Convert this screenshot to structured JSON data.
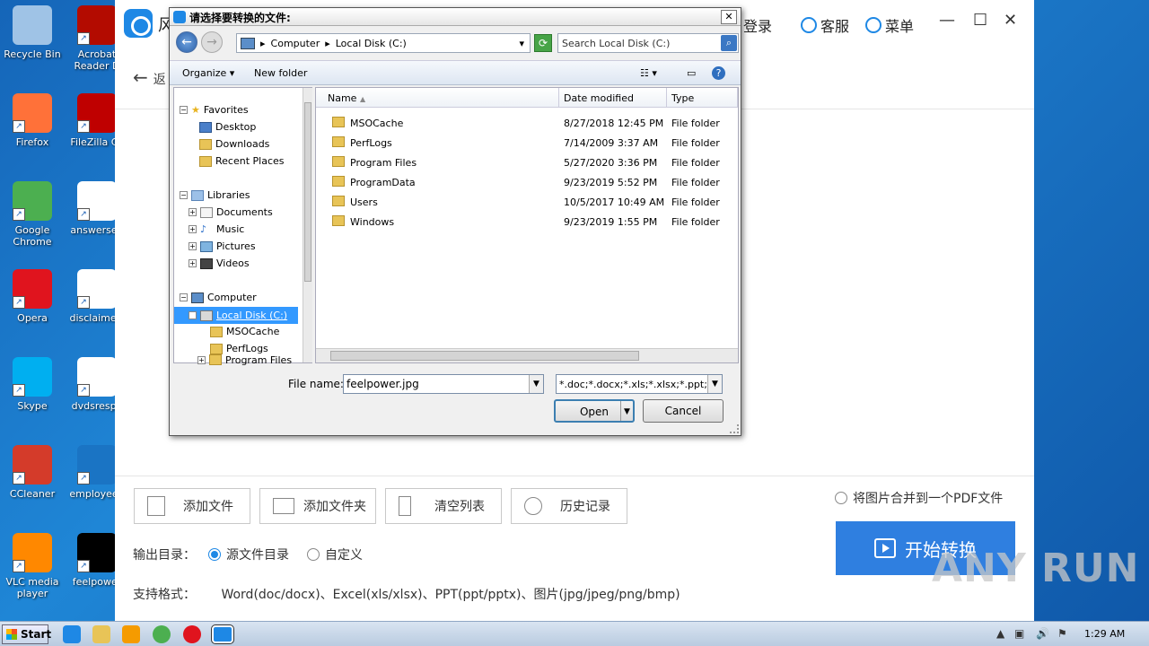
{
  "desktop": {
    "icons": [
      {
        "label": "Recycle Bin",
        "icon": "recycle-bin-icon",
        "color": "#9fc3e6"
      },
      {
        "label": "Firefox",
        "icon": "firefox-icon",
        "color": "#ff7139"
      },
      {
        "label": "Google Chrome",
        "icon": "chrome-icon",
        "color": "#4caf50"
      },
      {
        "label": "Opera",
        "icon": "opera-icon",
        "color": "#e0141e"
      },
      {
        "label": "Skype",
        "icon": "skype-icon",
        "color": "#00aff0"
      },
      {
        "label": "CCleaner",
        "icon": "ccleaner-icon",
        "color": "#d43b2a"
      },
      {
        "label": "VLC media player",
        "icon": "vlc-icon",
        "color": "#ff8800"
      },
      {
        "label": "Acrobat Reader D",
        "icon": "acrobat-icon",
        "color": "#b30b00"
      },
      {
        "label": "FileZilla Cli",
        "icon": "filezilla-icon",
        "color": "#bf0000"
      },
      {
        "label": "answersen",
        "icon": "word-doc-icon",
        "color": "#ffffff"
      },
      {
        "label": "disclaimerr",
        "icon": "word-doc-icon",
        "color": "#ffffff"
      },
      {
        "label": "dvdsrespe",
        "icon": "word-doc-icon",
        "color": "#ffffff"
      },
      {
        "label": "employeep",
        "icon": "blank-icon",
        "color": "#1a74c4"
      },
      {
        "label": "feelpower",
        "icon": "image-file-icon",
        "color": "#000000"
      }
    ]
  },
  "app": {
    "title": "风",
    "login": "登录",
    "service": "客服",
    "menu": "菜单",
    "back_label": "返",
    "actions": {
      "add_file": "添加文件",
      "add_folder": "添加文件夹",
      "clear_list": "清空列表",
      "history": "历史记录"
    },
    "merge_label": "将图片合并到一个PDF文件",
    "start_label": "开始转换",
    "output_dir_label": "输出目录：",
    "output_source": "源文件目录",
    "output_custom": "自定义",
    "formats_label": "支持格式：",
    "formats_value": "Word(doc/docx)、Excel(xls/xlsx)、PPT(ppt/pptx)、图片(jpg/jpeg/png/bmp)",
    "accent": "#2f7fe0"
  },
  "watermark": "ANY RUN",
  "dialog": {
    "title": "请选择要转换的文件:",
    "breadcrumb": [
      "Computer",
      "Local Disk (C:)"
    ],
    "search_placeholder": "Search Local Disk (C:)",
    "organize": "Organize",
    "new_folder": "New folder",
    "nav": {
      "favorites": "Favorites",
      "desktop": "Desktop",
      "downloads": "Downloads",
      "recent_places": "Recent Places",
      "libraries": "Libraries",
      "documents": "Documents",
      "music": "Music",
      "pictures": "Pictures",
      "videos": "Videos",
      "computer": "Computer",
      "local_disk": "Local Disk (C:)",
      "msocache": "MSOCache",
      "perflogs": "PerfLogs",
      "program_files": "Program Files"
    },
    "columns": {
      "name": "Name",
      "date": "Date modified",
      "type": "Type"
    },
    "files": [
      {
        "name": "MSOCache",
        "date": "8/27/2018 12:45 PM",
        "type": "File folder"
      },
      {
        "name": "PerfLogs",
        "date": "7/14/2009 3:37 AM",
        "type": "File folder"
      },
      {
        "name": "Program Files",
        "date": "5/27/2020 3:36 PM",
        "type": "File folder"
      },
      {
        "name": "ProgramData",
        "date": "9/23/2019 5:52 PM",
        "type": "File folder"
      },
      {
        "name": "Users",
        "date": "10/5/2017 10:49 AM",
        "type": "File folder"
      },
      {
        "name": "Windows",
        "date": "9/23/2019 1:55 PM",
        "type": "File folder"
      }
    ],
    "file_name_label": "File name:",
    "file_name_value": "feelpower.jpg",
    "filter_value": "*.doc;*.docx;*.xls;*.xlsx;*.ppt;*.p",
    "open": "Open",
    "cancel": "Cancel"
  },
  "taskbar": {
    "start": "Start",
    "clock": "1:29 AM"
  }
}
